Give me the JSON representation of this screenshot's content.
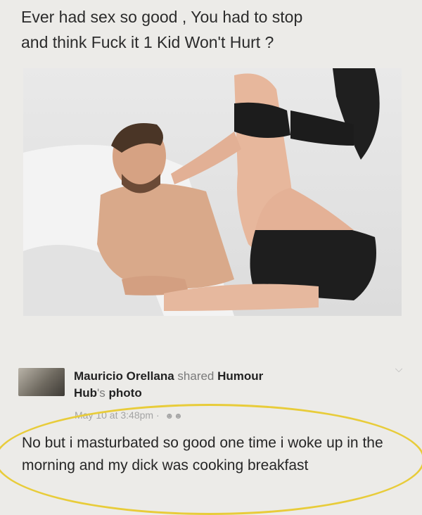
{
  "caption": {
    "line1": "Ever had sex so good , You had to stop",
    "line2": "and think  Fuck it 1 Kid Won't Hurt ?"
  },
  "photo": {
    "icon": "photo-couple-bed"
  },
  "post": {
    "author": "Mauricio Orellana",
    "action": "shared",
    "page_name": "Humour",
    "page_name_cont": "Hub",
    "possessive": "'s",
    "object": "photo",
    "timestamp": "May 10 at 3:48pm",
    "separator": "·",
    "audience_icon": "friends-icon",
    "menu_icon": "chevron-down-icon"
  },
  "comment": {
    "text": "No but i masturbated so good one time i woke up in the morning and my dick was cooking breakfast"
  },
  "colors": {
    "highlight": "#e8cc3a",
    "background": "#ecebe8"
  }
}
